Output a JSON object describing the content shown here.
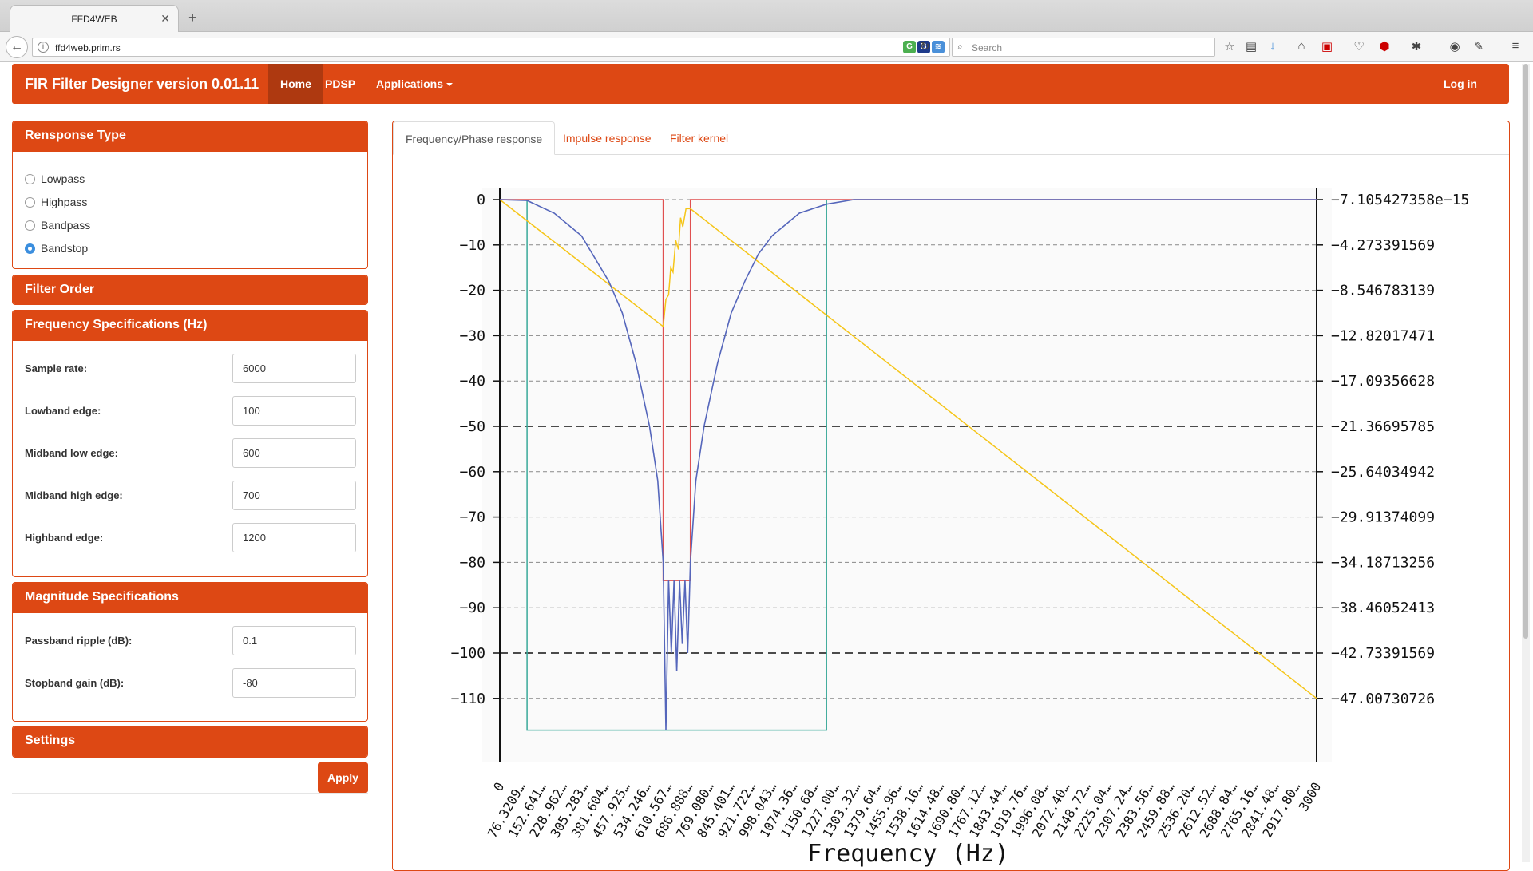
{
  "browser": {
    "tab_title": "FFD4WEB",
    "url": "ffd4web.prim.rs",
    "search_placeholder": "Search"
  },
  "app": {
    "brand": "FIR Filter Designer version 0.01.11",
    "nav": {
      "home": "Home",
      "pdsp": "PDSP",
      "applications": "Applications",
      "login": "Log in"
    }
  },
  "response_type": {
    "title": "Rensponse Type",
    "options": [
      "Lowpass",
      "Highpass",
      "Bandpass",
      "Bandstop"
    ],
    "selected": "Bandstop"
  },
  "filter_order": {
    "title": "Filter Order"
  },
  "frequency_specs": {
    "title": "Frequency Specifications (Hz)",
    "fields": [
      {
        "label": "Sample rate:",
        "value": "6000"
      },
      {
        "label": "Lowband edge:",
        "value": "100"
      },
      {
        "label": "Midband low edge:",
        "value": "600"
      },
      {
        "label": "Midband high edge:",
        "value": "700"
      },
      {
        "label": "Highband edge:",
        "value": "1200"
      }
    ]
  },
  "magnitude_specs": {
    "title": "Magnitude Specifications",
    "fields": [
      {
        "label": "Passband ripple (dB):",
        "value": "0.1"
      },
      {
        "label": "Stopband gain (dB):",
        "value": "-80"
      }
    ]
  },
  "settings": {
    "title": "Settings",
    "apply": "Apply"
  },
  "tabs": [
    "Frequency/Phase response",
    "Impulse response",
    "Filter kernel"
  ],
  "colors": {
    "accent": "#dd4814",
    "accent_dark": "#ae3910",
    "magnitude": "#5566bb",
    "phase": "#f5c518",
    "spec": "#e05050",
    "passband": "#3aa99a"
  },
  "chart_data": {
    "type": "line",
    "xlabel": "Frequency (Hz)",
    "xlim": [
      0,
      3000
    ],
    "ylim_left": [
      -117,
      0
    ],
    "ylim_right": [
      -47.00730726,
      -7.105427358e-15
    ],
    "left_ticks": [
      0,
      -10,
      -20,
      -30,
      -40,
      -50,
      -60,
      -70,
      -80,
      -90,
      -100,
      -110
    ],
    "right_ticks": [
      "−7.105427358e−15",
      "−4.273391569",
      "−8.546783139",
      "−12.82017471",
      "−17.09356628",
      "−21.36695785",
      "−25.64034942",
      "−29.91374099",
      "−34.18713256",
      "−38.46052413",
      "−42.73391569",
      "−47.00730726"
    ],
    "x_ticks": [
      "0",
      "76.3209…",
      "152.641…",
      "228.962…",
      "305.283…",
      "381.604…",
      "457.925…",
      "534.246…",
      "610.567…",
      "686.888…",
      "769.080…",
      "845.401…",
      "921.722…",
      "998.043…",
      "1074.36…",
      "1150.68…",
      "1227.00…",
      "1303.32…",
      "1379.64…",
      "1455.96…",
      "1538.16…",
      "1614.48…",
      "1690.80…",
      "1767.12…",
      "1843.44…",
      "1919.76…",
      "1996.08…",
      "2072.40…",
      "2148.72…",
      "2225.04…",
      "2307.24…",
      "2383.56…",
      "2459.88…",
      "2536.20…",
      "2612.52…",
      "2688.84…",
      "2765.16…",
      "2841.48…",
      "2917.80…",
      "3000"
    ],
    "dashed_major": [
      -50,
      -100
    ],
    "series": [
      {
        "role": "magnitude_db",
        "x": [
          0,
          100,
          200,
          300,
          400,
          450,
          500,
          550,
          580,
          600,
          610,
          620,
          630,
          640,
          650,
          660,
          670,
          680,
          690,
          700,
          720,
          750,
          800,
          850,
          900,
          950,
          1000,
          1100,
          1200,
          1300,
          3000
        ],
        "y": [
          0,
          -0.2,
          -3,
          -8,
          -18,
          -25,
          -36,
          -50,
          -62,
          -80,
          -117,
          -84,
          -100,
          -84,
          -104,
          -84,
          -98,
          -84,
          -100,
          -80,
          -62,
          -50,
          -36,
          -25,
          -18,
          -12,
          -8,
          -3,
          -1,
          0,
          0
        ]
      },
      {
        "role": "phase",
        "x": [
          0,
          600,
          610,
          620,
          628,
          636,
          646,
          656,
          664,
          672,
          684,
          700,
          3000
        ],
        "y": [
          0,
          -28,
          -22,
          -21,
          -15,
          -16,
          -9,
          -11,
          -4,
          -6,
          -2,
          -2,
          -110
        ]
      },
      {
        "role": "spec_mask",
        "x": [
          0,
          600,
          600,
          700,
          700,
          3000
        ],
        "y": [
          0,
          0,
          -84,
          -84,
          0,
          0
        ]
      },
      {
        "role": "passband_mask",
        "x": [
          100,
          100,
          1200,
          1200
        ],
        "y": [
          0,
          -117,
          -117,
          0
        ]
      }
    ]
  }
}
